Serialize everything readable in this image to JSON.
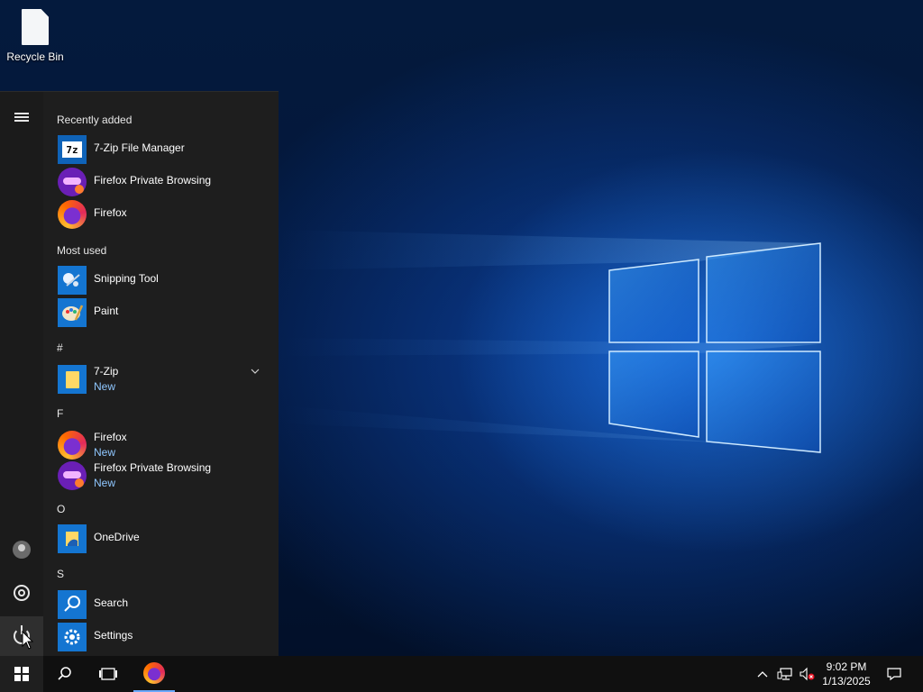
{
  "desktop": {
    "icons": [
      {
        "label": "Recycle Bin",
        "icon": "recycle-bin-icon"
      }
    ]
  },
  "start_menu": {
    "sections": {
      "recently_added": "Recently added",
      "most_used": "Most used",
      "hash": "#",
      "f": "F",
      "o": "O",
      "s": "S"
    },
    "recently_added": [
      {
        "name": "7-Zip File Manager",
        "icon": "7zip-icon"
      },
      {
        "name": "Firefox Private Browsing",
        "icon": "firefox-private-icon"
      },
      {
        "name": "Firefox",
        "icon": "firefox-icon"
      }
    ],
    "most_used": [
      {
        "name": "Snipping Tool",
        "icon": "snipping-tool-icon"
      },
      {
        "name": "Paint",
        "icon": "paint-icon"
      }
    ],
    "all_apps": {
      "zip_folder": {
        "name": "7-Zip",
        "sub": "New",
        "icon": "folder-icon"
      },
      "firefox": {
        "name": "Firefox",
        "sub": "New",
        "icon": "firefox-icon"
      },
      "firefox_private": {
        "name": "Firefox Private Browsing",
        "sub": "New",
        "icon": "firefox-private-icon"
      },
      "onedrive": {
        "name": "OneDrive",
        "icon": "onedrive-icon"
      },
      "search": {
        "name": "Search",
        "icon": "search-icon"
      },
      "settings": {
        "name": "Settings",
        "icon": "gear-icon"
      }
    },
    "rail": [
      "hamburger-icon",
      "user-avatar-icon",
      "gear-icon",
      "power-icon"
    ]
  },
  "taskbar": {
    "items": [
      "windows-start-icon",
      "search-icon",
      "task-view-icon",
      "firefox-icon"
    ],
    "tray": [
      "chevron-up-icon",
      "network-icon",
      "volume-muted-icon",
      "action-center-icon"
    ],
    "time": "9:02 PM",
    "date": "1/13/2025"
  },
  "colors": {
    "accent": "#1475d1",
    "menu_bg": "#1e1e1e",
    "new_label": "#8fc7ff"
  }
}
